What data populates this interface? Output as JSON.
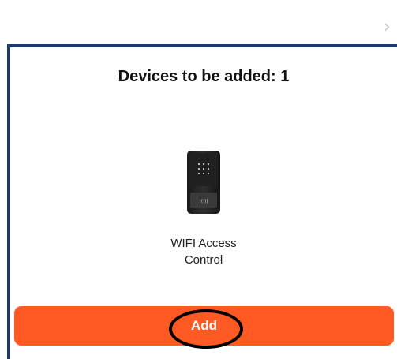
{
  "close_icon": "chevron-right-icon",
  "dialog": {
    "title": "Devices to be added: 1",
    "device": {
      "icon": "access-control-keypad-icon",
      "name_line1": "WIFI Access",
      "name_line2": "Control"
    },
    "add_button_label": "Add",
    "accent_color": "#ff5a23"
  }
}
